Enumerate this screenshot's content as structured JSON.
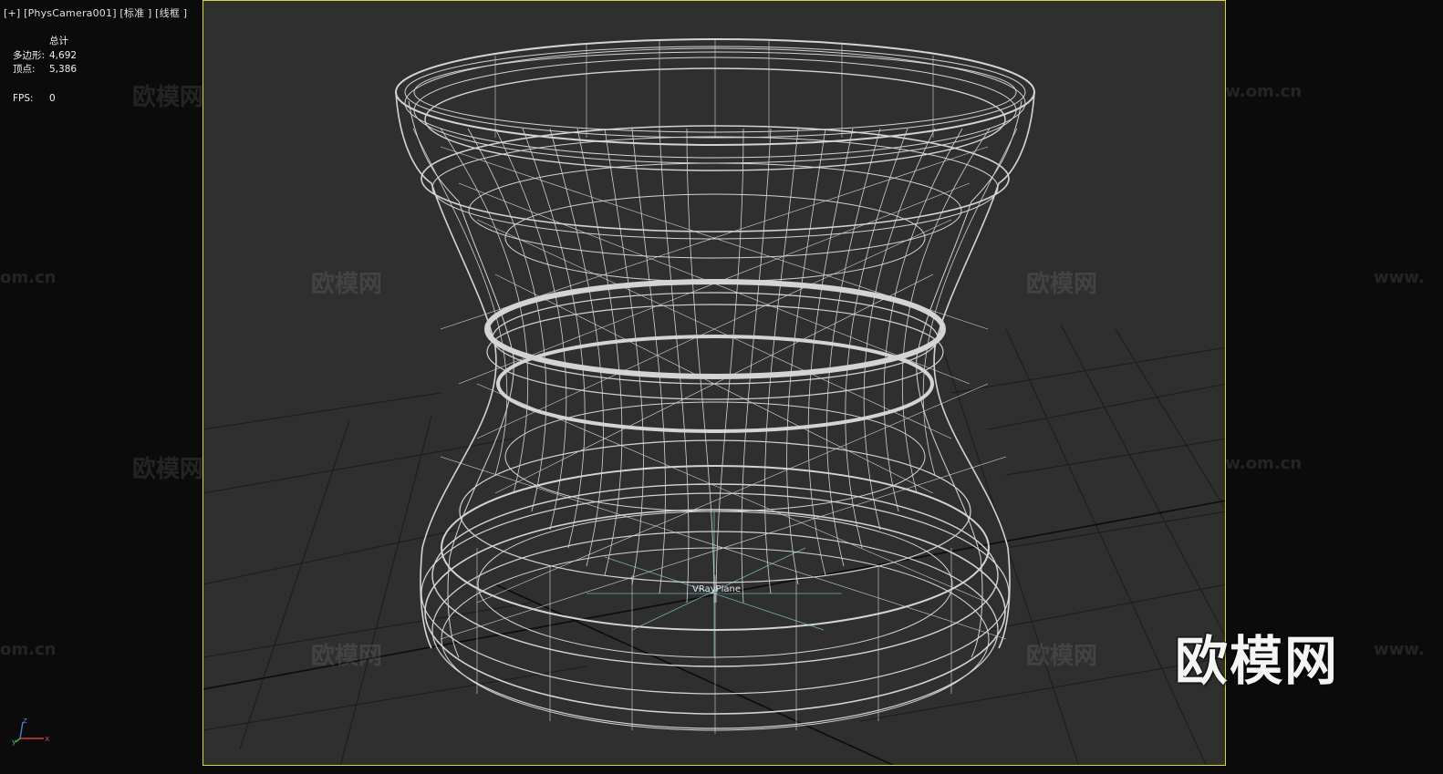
{
  "viewport": {
    "label": "[+]  [PhysCamera001]  [标准 ]  [线框 ]"
  },
  "stats": {
    "header": "总计",
    "polys_label": "多边形:",
    "polys_value": "4,692",
    "verts_label": "顶点:",
    "verts_value": "5,386",
    "fps_label": "FPS:",
    "fps_value": "0"
  },
  "scene": {
    "object_label": "VRayPlane",
    "wireframe_color": "#d4d4d4",
    "grid_color": "#1c1c1c",
    "background_color": "#2f2f2f",
    "active_border_color": "#d8d83a"
  },
  "watermarks": {
    "cn": "欧模网",
    "url": "www.om.cn",
    "url_fragment_left": "om.cn",
    "url_fragment_right": "www."
  },
  "logo": {
    "text": "欧模网"
  },
  "gizmo": {
    "x_label": "x",
    "y_label": "y",
    "z_label": "z"
  }
}
